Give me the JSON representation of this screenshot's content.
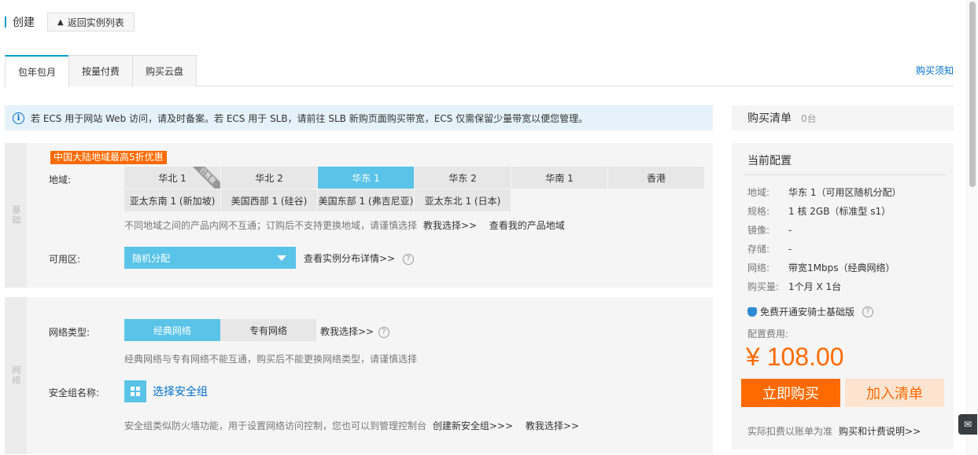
{
  "header": {
    "title": "创建",
    "back_label": "返回实例列表",
    "back_icon": "up-arrow-icon"
  },
  "tabs": [
    {
      "label": "包年包月",
      "active": true
    },
    {
      "label": "按量付费",
      "active": false
    },
    {
      "label": "购买云盘",
      "active": false
    }
  ],
  "buy_notice": "购买须知",
  "notice": {
    "icon": "info-icon",
    "text": "若 ECS 用于网站 Web 访问，请及时备案。若 ECS 用于 SLB，请前往 SLB 新购页面购买带宽，ECS 仅需保留少量带宽以便您管理。"
  },
  "basic": {
    "side_label": "基础",
    "promo": "中国大陆地域最高5折优惠",
    "region_label": "地域:",
    "regions": [
      {
        "label": "华北 1",
        "tag": "已售罄"
      },
      {
        "label": "华北 2"
      },
      {
        "label": "华东 1",
        "active": true
      },
      {
        "label": "华东 2"
      },
      {
        "label": "华南 1"
      },
      {
        "label": "香港"
      },
      {
        "label": "亚太东南 1 (新加坡)"
      },
      {
        "label": "美国西部 1 (硅谷)"
      },
      {
        "label": "美国东部 1 (弗吉尼亚)"
      },
      {
        "label": "亚太东北 1 (日本)"
      }
    ],
    "region_tip": "不同地域之间的产品内网不互通；订购后不支持更换地域，请谨慎选择",
    "region_help_link": "教我选择>>",
    "region_my_link": "查看我的产品地域",
    "zone_label": "可用区:",
    "zone_value": "随机分配",
    "zone_link": "查看实例分布详情>>",
    "help_mark": "?"
  },
  "network": {
    "side_label": "网络",
    "type_label": "网络类型:",
    "types": [
      {
        "label": "经典网络",
        "active": true
      },
      {
        "label": "专有网络",
        "active": false
      }
    ],
    "type_help_link": "教我选择>>",
    "type_tip": "经典网络与专有网络不能互通，购买后不能更换网络类型，请谨慎选择",
    "sg_label": "安全组名称:",
    "sg_button": "选择安全组",
    "sg_tip": "安全组类似防火墙功能，用于设置网络访问控制，您也可以到管理控制台",
    "sg_create_link": "创建新安全组>>>",
    "sg_help_link": "教我选择>>"
  },
  "cart": {
    "title": "购买清单",
    "count": "0台"
  },
  "config": {
    "title": "当前配置",
    "rows": [
      {
        "key": "地域:",
        "value": "华东 1（可用区随机分配）"
      },
      {
        "key": "规格:",
        "value": "1 核 2GB（标准型 s1）"
      },
      {
        "key": "镜像:",
        "value": "-"
      },
      {
        "key": "存储:",
        "value": "-"
      },
      {
        "key": "网络:",
        "value": "带宽1Mbps（经典网络）"
      },
      {
        "key": "购买量:",
        "value": "1个月 X 1台"
      }
    ],
    "shield_text": "免费开通安骑士基础版",
    "fee_label": "配置费用:",
    "price": "¥ 108.00",
    "buy_button": "立即购买",
    "add_button": "加入清单",
    "bill_note": "实际扣费以账单为准",
    "bill_link": "购买和计费说明>>"
  },
  "colors": {
    "accent": "#00a2ca",
    "selected": "#59c3e8",
    "price": "#ff6a00",
    "link": "#0070cc"
  }
}
